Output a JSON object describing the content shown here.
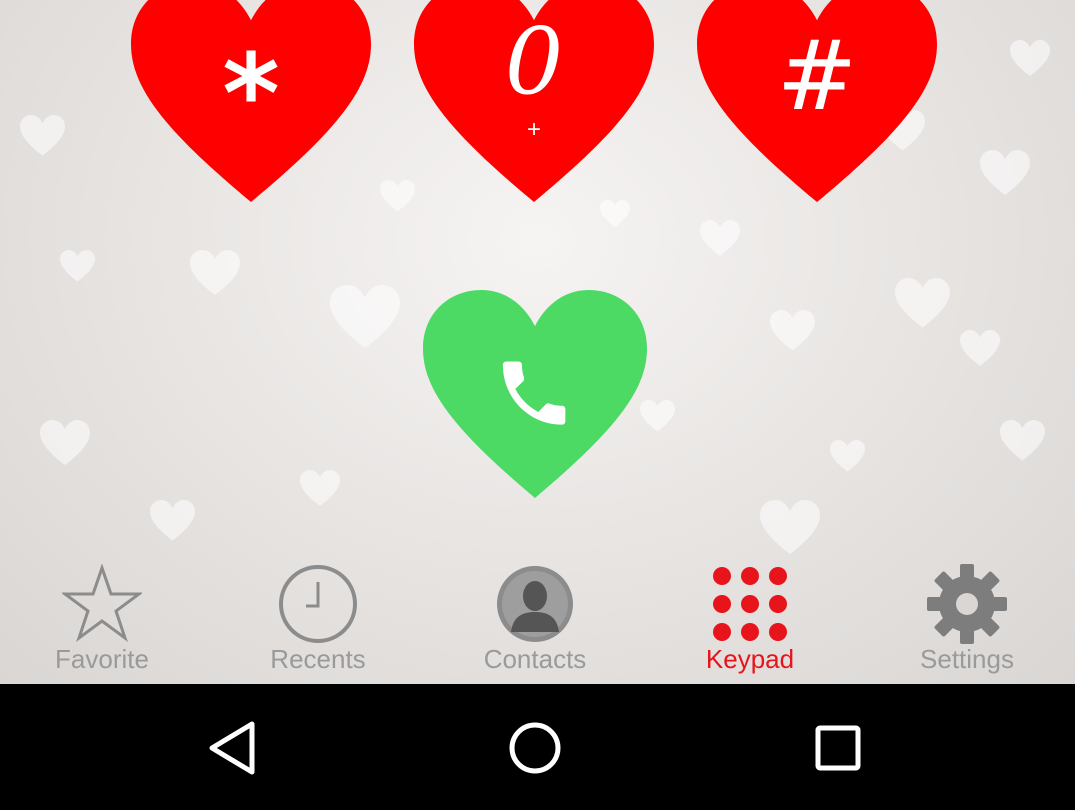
{
  "keypad": {
    "keys": [
      {
        "glyph": "*",
        "sub": ""
      },
      {
        "glyph": "0",
        "sub": "+"
      },
      {
        "glyph": "#",
        "sub": ""
      }
    ]
  },
  "tabs": [
    {
      "label": "Favorite",
      "icon": "star-icon",
      "active": false
    },
    {
      "label": "Recents",
      "icon": "clock-icon",
      "active": false
    },
    {
      "label": "Contacts",
      "icon": "contact-person-icon",
      "active": false
    },
    {
      "label": "Keypad",
      "icon": "keypad-dots-icon",
      "active": true
    },
    {
      "label": "Settings",
      "icon": "gear-icon",
      "active": false
    }
  ],
  "colors": {
    "key_heart": "#ff0000",
    "call_heart": "#4cd964",
    "active_tab": "#e8141b",
    "inactive_tab": "#9a9a9a"
  }
}
